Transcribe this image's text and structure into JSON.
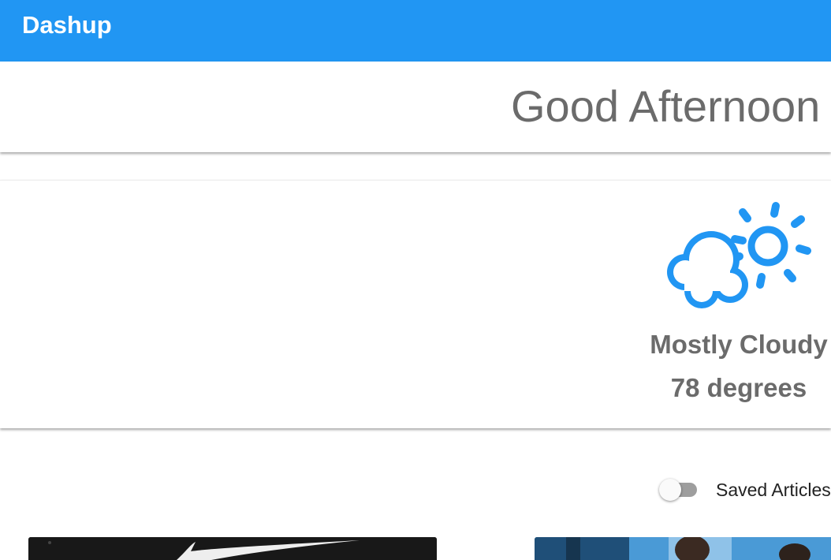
{
  "app": {
    "title": "Dashup",
    "accent_color": "#2196F3"
  },
  "greeting": {
    "text": "Good Afternoon"
  },
  "weather": {
    "icon": "partly-cloudy-icon",
    "condition": "Mostly Cloudy",
    "temperature": "78 degrees"
  },
  "saved_articles_toggle": {
    "label": "Saved Articles",
    "checked": false
  },
  "articles": [
    {
      "thumbnail": "article-thumbnail-1"
    },
    {
      "thumbnail": "article-thumbnail-2"
    }
  ]
}
